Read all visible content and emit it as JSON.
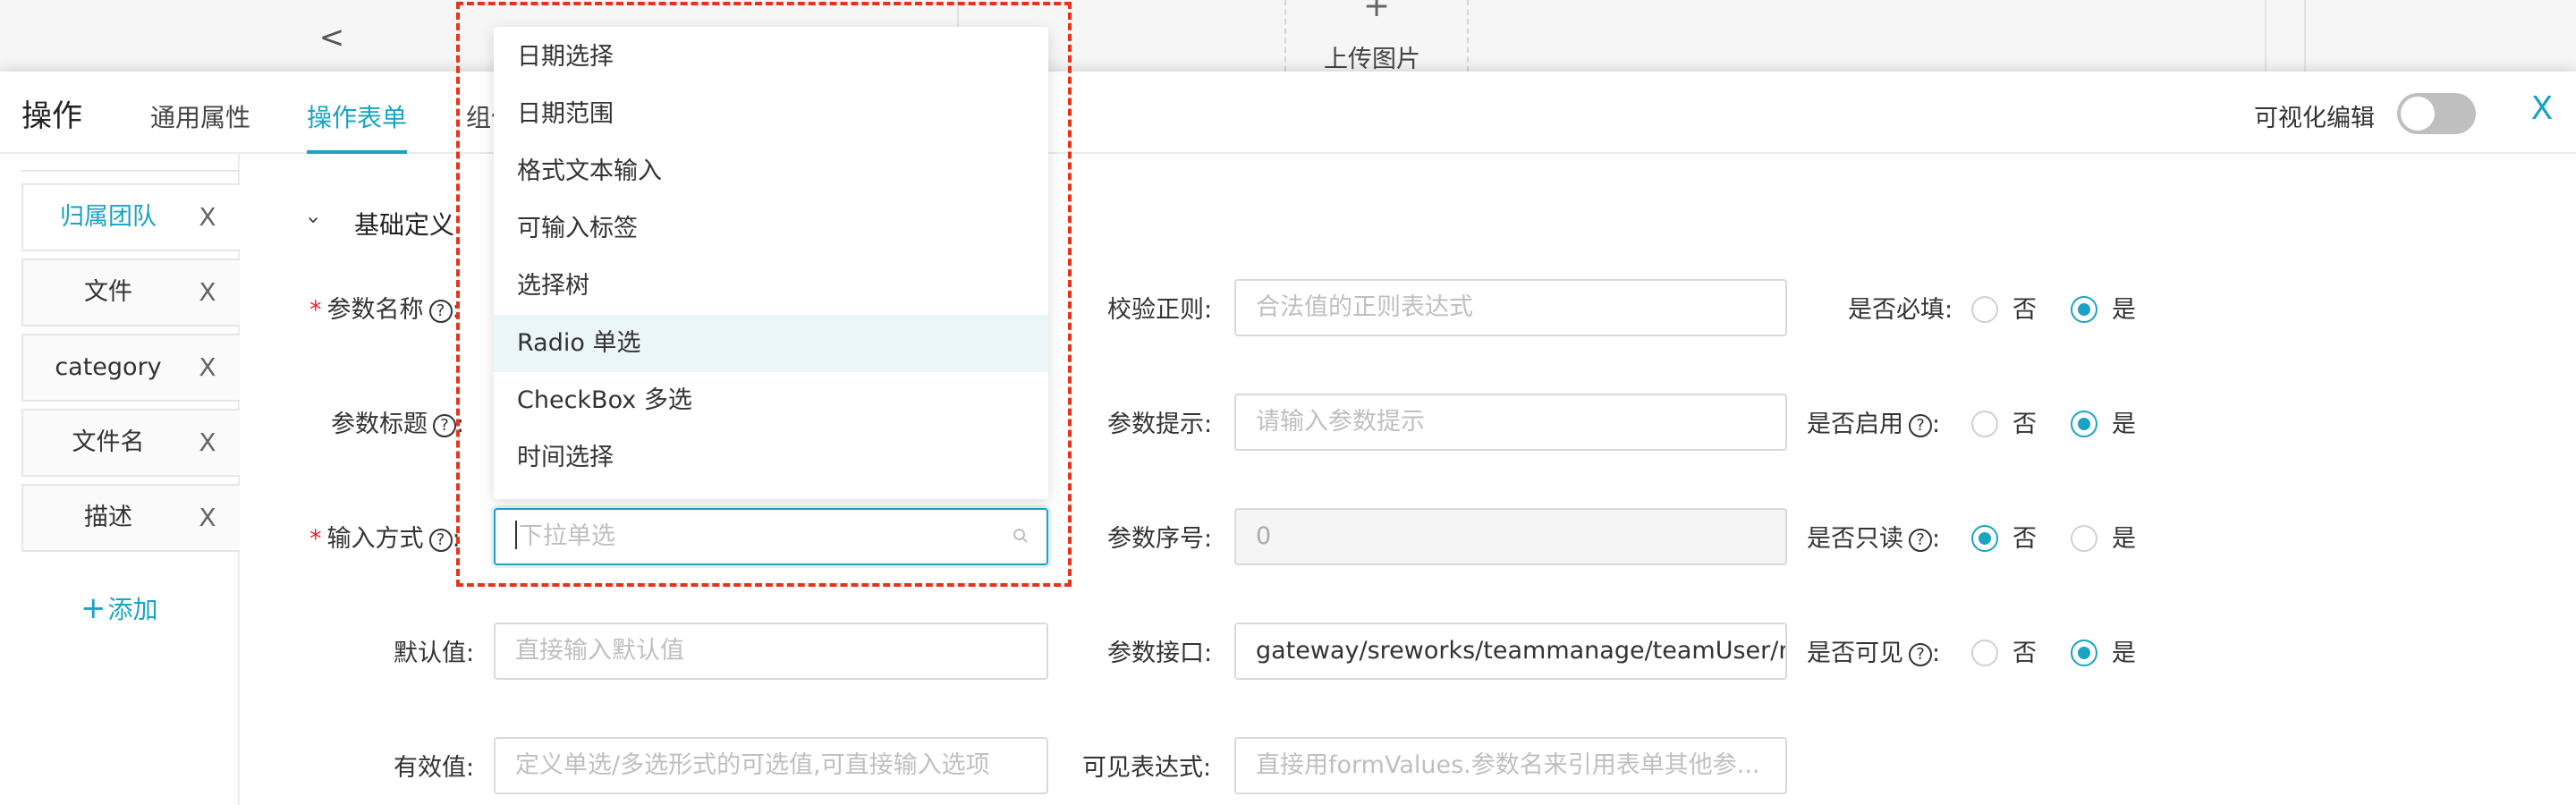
{
  "background": {
    "upload_label": "上传图片",
    "plus": "+",
    "back": "<"
  },
  "drawer": {
    "title": "操作",
    "tabs": [
      {
        "label": "通用属性",
        "active": false
      },
      {
        "label": "操作表单",
        "active": true
      },
      {
        "label": "组件",
        "active": false
      }
    ],
    "visual_edit_label": "可视化编辑",
    "visual_edit_on": false,
    "close": "X"
  },
  "fields": [
    {
      "name": "归属团队",
      "active": true
    },
    {
      "name": "文件",
      "active": false
    },
    {
      "name": "category",
      "active": false
    },
    {
      "name": "文件名",
      "active": false
    },
    {
      "name": "描述",
      "active": false
    }
  ],
  "remove_icon": "X",
  "add_label": "添加",
  "add_plus": "+",
  "section_title": "基础定义",
  "form": {
    "param_name": {
      "label": "参数名称"
    },
    "param_title": {
      "label": "参数标题"
    },
    "input_method": {
      "label": "输入方式",
      "placeholder": "下拉单选"
    },
    "default_value": {
      "label": "默认值:",
      "placeholder": "直接输入默认值"
    },
    "valid_values": {
      "label": "有效值:",
      "placeholder": "定义单选/多选形式的可选值,可直接输入选项"
    },
    "validation_rule": {
      "label": "校验正则:",
      "placeholder": "合法值的正则表达式"
    },
    "param_hint": {
      "label": "参数提示:",
      "placeholder": "请输入参数提示"
    },
    "param_order": {
      "label": "参数序号:",
      "value": "0"
    },
    "param_api": {
      "label": "参数接口:",
      "value": "gateway/sreworks/teammanage/teamUser/na"
    },
    "visible_expr": {
      "label": "可见表达式:",
      "placeholder": "直接用formValues.参数名来引用表单其他参..."
    },
    "required": {
      "label": "是否必填:",
      "value": "是"
    },
    "enabled": {
      "label": "是否启用",
      "value": "是"
    },
    "readonly": {
      "label": "是否只读",
      "value": "否"
    },
    "visible": {
      "label": "是否可见",
      "value": "是"
    },
    "option_no": "否",
    "option_yes": "是",
    "colon": ":",
    "qmark": "?",
    "req_mark": "*"
  },
  "dropdown": {
    "items": [
      "日期选择",
      "日期范围",
      "格式文本输入",
      "可输入标签",
      "选择树",
      "Radio 单选",
      "CheckBox 多选",
      "时间选择"
    ],
    "hovered": "Radio 单选"
  },
  "colors": {
    "accent": "#1aa3c2",
    "highlight_border": "#e8331a",
    "required": "#f5222d"
  }
}
